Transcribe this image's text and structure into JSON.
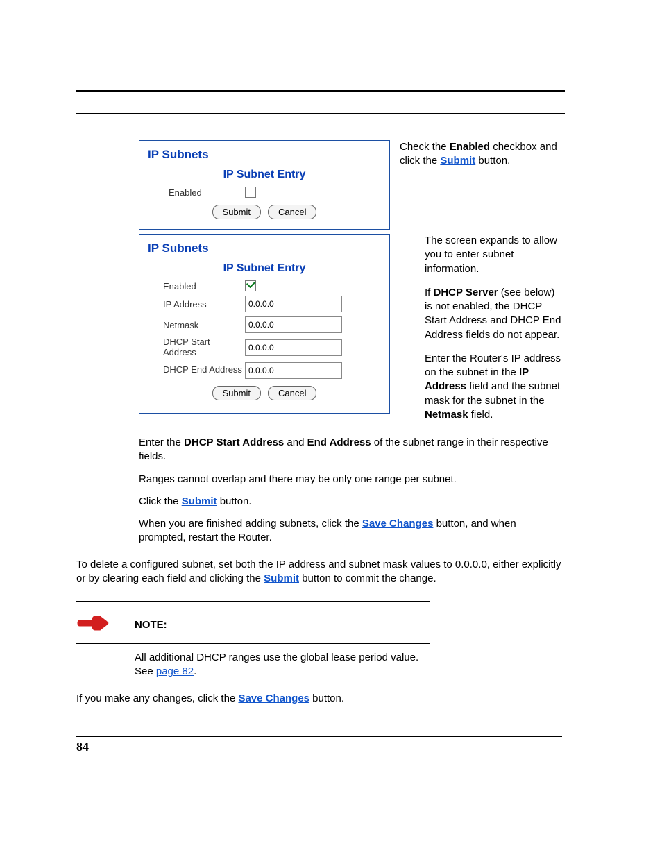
{
  "figure1": {
    "heading": "IP Subnets",
    "sub": "IP Subnet Entry",
    "rows": {
      "enabled": "Enabled"
    },
    "submit": "Submit",
    "cancel": "Cancel"
  },
  "side1": {
    "t1": "Check the ",
    "b1": "Enabled",
    "t2": " checkbox and click the ",
    "l1": "Submit",
    "t3": " button."
  },
  "figure2": {
    "heading": "IP Subnets",
    "sub": "IP Subnet Entry",
    "rows": {
      "enabled": "Enabled",
      "ip": "IP Address",
      "nm": "Netmask",
      "ds": "DHCP Start Address",
      "de": "DHCP End Address"
    },
    "vals": {
      "ip": "0.0.0.0",
      "nm": "0.0.0.0",
      "ds": "0.0.0.0",
      "de": "0.0.0.0"
    },
    "submit": "Submit",
    "cancel": "Cancel"
  },
  "side2": {
    "p1a": "The screen expands to allow you to enter subnet information.",
    "p2a": "If ",
    "p2b": "DHCP Server",
    "p2c": " (see below) is not enabled, the DHCP Start Address and DHCP End Address fields do not appear.",
    "p3a": "Enter the Router's IP address on the subnet in the ",
    "p3b": "IP Address",
    "p3c": " field and the subnet mask for the subnet in the ",
    "p3d": "Netmask",
    "p3e": " field."
  },
  "body": {
    "p1a": "Enter the ",
    "p1b": "DHCP Start Address",
    "p1c": " and ",
    "p1d": "End Address",
    "p1e": " of the subnet range in their respective fields.",
    "p2": "Ranges cannot overlap and there may be only one range per subnet.",
    "p3a": "Click the ",
    "p3l": "Submit",
    "p3b": " button.",
    "p4a": "When you are finished adding subnets, click the ",
    "p4l": "Save Changes",
    "p4b": " button, and when prompted, restart the Router."
  },
  "outer": {
    "p1a": "To delete a configured subnet, set both the IP address and subnet mask values to 0.0.0.0, either explicitly or by clearing each field and clicking the ",
    "p1l": "Submit",
    "p1b": " button to commit the change."
  },
  "note": {
    "label": "NOTE:",
    "t1": "All additional DHCP ranges use the global lease period value. See ",
    "l1": "page 82",
    "t2": "."
  },
  "after": {
    "t1": "If you make any changes, click the ",
    "l1": "Save Changes",
    "t2": " button."
  },
  "page_no": "84"
}
